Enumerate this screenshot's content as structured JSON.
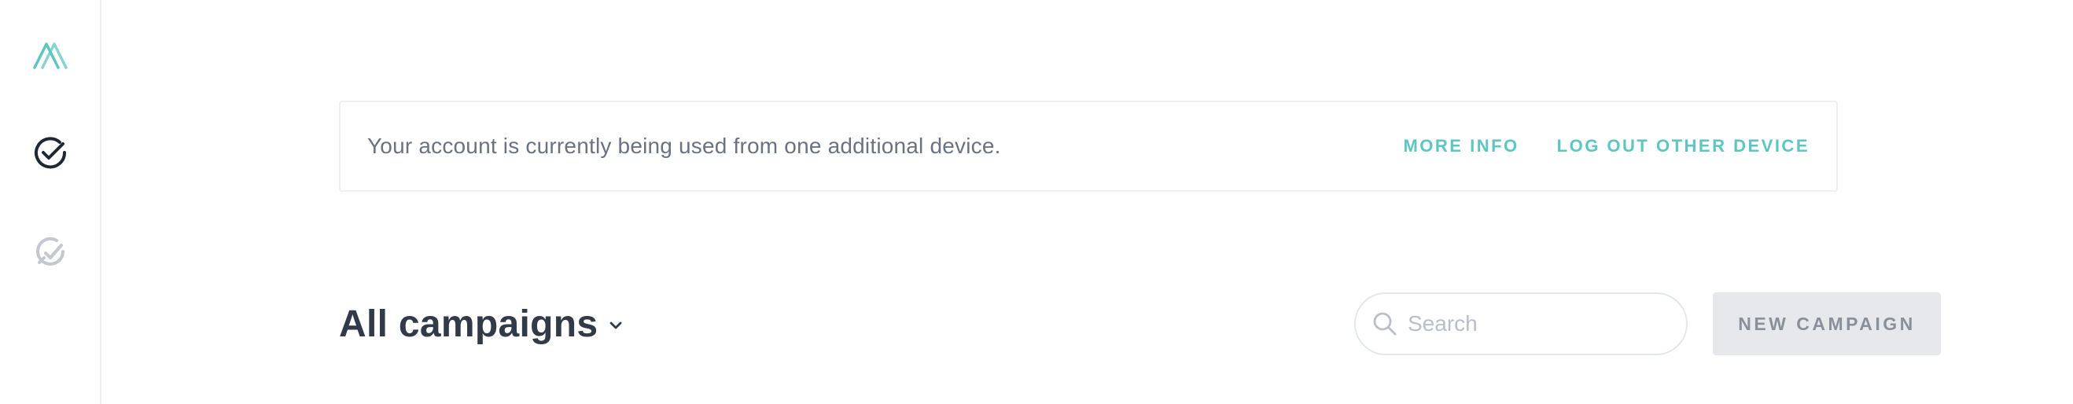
{
  "sidebar": {
    "logo_icon": "brand-logo-icon",
    "items": [
      {
        "icon": "check-circle-icon",
        "active": true
      },
      {
        "icon": "wrench-icon",
        "active": false
      }
    ]
  },
  "notice": {
    "message": "Your account is currently being used from one additional device.",
    "more_info_label": "MORE INFO",
    "logout_label": "LOG OUT OTHER DEVICE"
  },
  "header": {
    "title": "All campaigns",
    "search_placeholder": "Search",
    "search_value": "",
    "new_campaign_label": "NEW CAMPAIGN"
  },
  "colors": {
    "accent": "#5ec6c0",
    "title": "#323a48",
    "muted_text": "#6b7280",
    "button_bg": "#e6e8ec",
    "border": "#eef0f3"
  }
}
